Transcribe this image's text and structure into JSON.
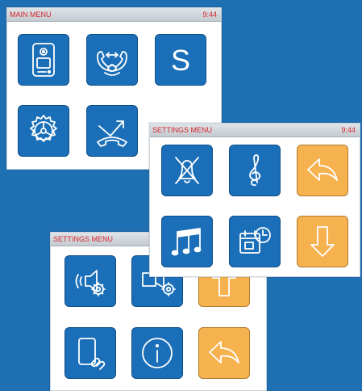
{
  "colors": {
    "background": "#1f6fb3",
    "tile_blue": "#1a6fb8",
    "tile_orange": "#f7b250",
    "title_text": "#d6262b"
  },
  "main_menu": {
    "title": "MAIN MENU",
    "time": "9:44",
    "tiles": [
      {
        "icon": "door-intercom-icon"
      },
      {
        "icon": "intercom-call-icon"
      },
      {
        "icon": "s-letter-icon",
        "text": "S"
      },
      {
        "icon": "settings-gear-icon"
      },
      {
        "icon": "missed-call-icon"
      }
    ]
  },
  "settings_menu_right": {
    "title": "SETTINGS MENU",
    "time": "9:44",
    "tiles": [
      {
        "icon": "mute-bell-icon"
      },
      {
        "icon": "treble-clef-icon"
      },
      {
        "icon": "back-arrow-icon"
      },
      {
        "icon": "music-notes-icon"
      },
      {
        "icon": "calendar-clock-icon"
      },
      {
        "icon": "down-arrow-icon"
      }
    ]
  },
  "settings_menu_left": {
    "title": "SETTINGS MENU",
    "tiles": [
      {
        "icon": "speaker-settings-icon"
      },
      {
        "icon": "video-settings-icon"
      },
      {
        "icon": "up-arrow-icon"
      },
      {
        "icon": "device-link-icon"
      },
      {
        "icon": "info-icon"
      },
      {
        "icon": "back-arrow-icon"
      }
    ]
  }
}
